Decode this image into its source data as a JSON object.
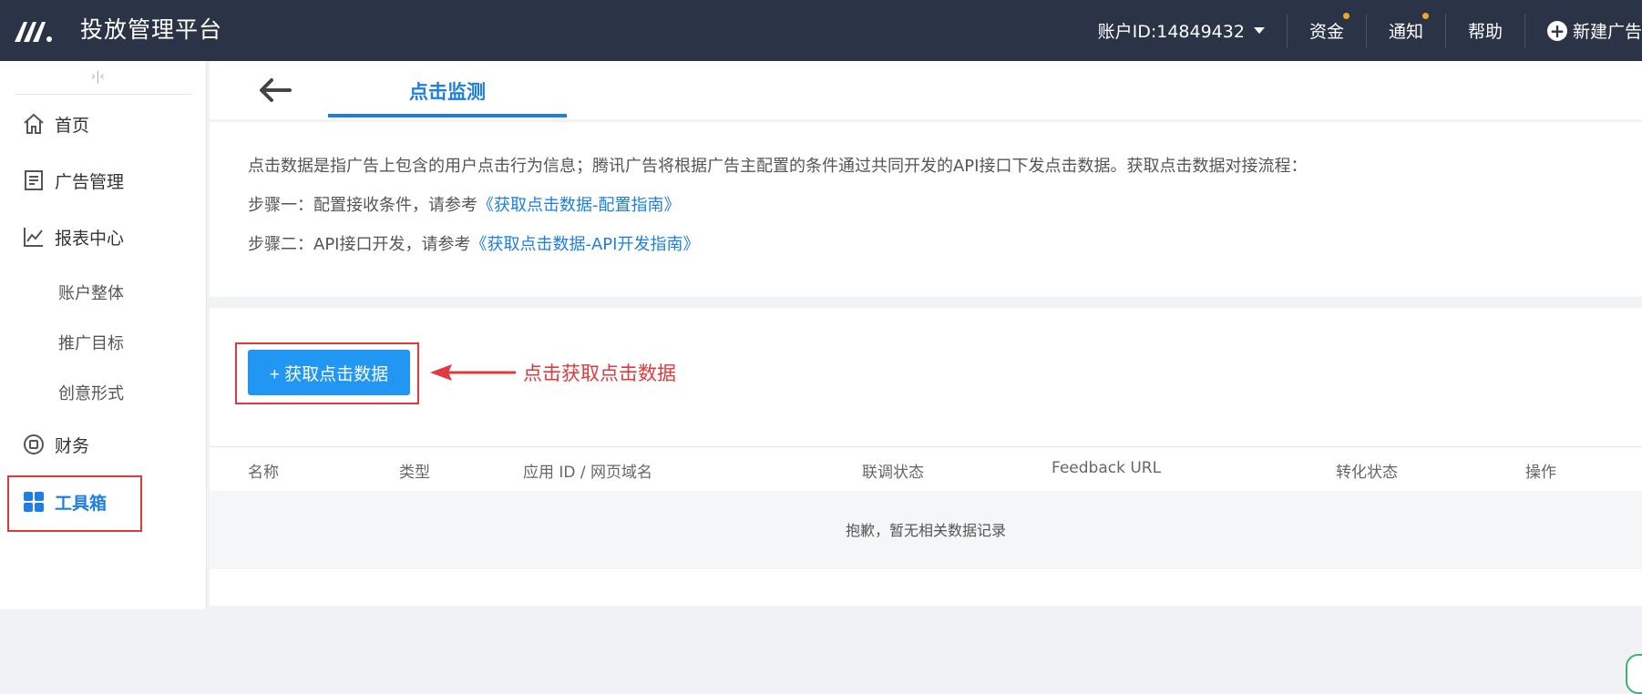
{
  "header": {
    "app_title": "投放管理平台",
    "account_label": "账户ID:14849432",
    "links": [
      "资金",
      "通知",
      "帮助"
    ],
    "new_ad_label": "新建广告"
  },
  "sidebar": {
    "collapse_glyph": "›|‹",
    "items": [
      {
        "label": "首页",
        "icon": "home-icon"
      },
      {
        "label": "广告管理",
        "icon": "document-icon"
      },
      {
        "label": "报表中心",
        "icon": "line-chart-icon"
      },
      {
        "label": "财务",
        "icon": "coin-icon"
      },
      {
        "label": "工具箱",
        "icon": "grid-icon"
      }
    ],
    "report_subitems": [
      "账户整体",
      "推广目标",
      "创意形式"
    ]
  },
  "tabs": {
    "active_label": "点击监测"
  },
  "info": {
    "line1": "点击数据是指广告上包含的用户点击行为信息；腾讯广告将根据广告主配置的条件通过共同开发的API接口下发点击数据。获取点击数据对接流程：",
    "step1_prefix": "步骤一：配置接收条件，请参考",
    "step1_link": "《获取点击数据-配置指南》",
    "step2_prefix": "步骤二：API接口开发，请参考",
    "step2_link": "《获取点击数据-API开发指南》"
  },
  "actions": {
    "fetch_button": "+ 获取点击数据",
    "annotation": "点击获取点击数据"
  },
  "table": {
    "columns": [
      "名称",
      "类型",
      "应用 ID / 网页域名",
      "联调状态",
      "Feedback URL",
      "转化状态",
      "操作"
    ],
    "empty_text": "抱歉，暂无相关数据记录"
  },
  "colors": {
    "topbar": "#2b3447",
    "accent": "#1e7fe0",
    "button": "#2196f3",
    "annotation_red": "#e0393e",
    "notify_dot": "#f5a623"
  }
}
